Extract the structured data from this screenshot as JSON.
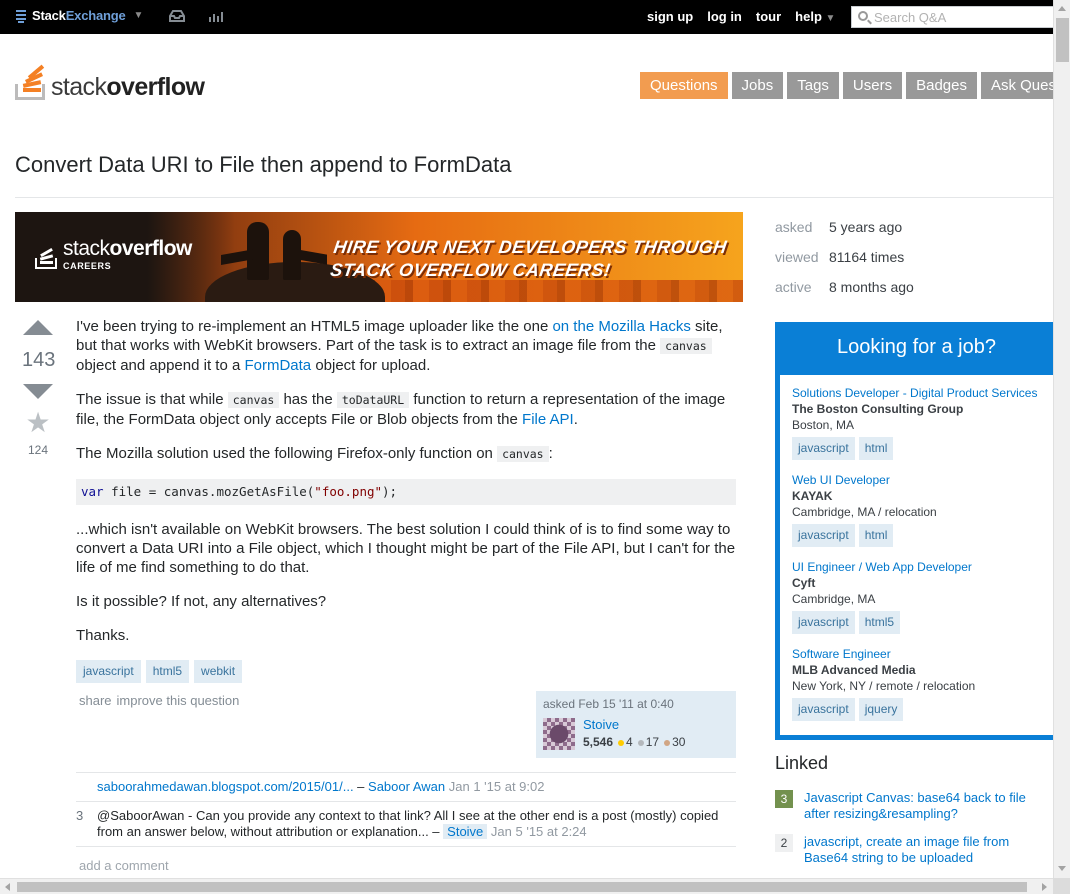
{
  "topbar": {
    "brand_a": "Stack",
    "brand_b": "Exchange",
    "links": [
      "sign up",
      "log in",
      "tour",
      "help"
    ],
    "search_placeholder": "Search Q&A"
  },
  "header": {
    "logo_a": "stack",
    "logo_b": "overflow",
    "nav": [
      "Questions",
      "Jobs",
      "Tags",
      "Users",
      "Badges",
      "Ask Question"
    ]
  },
  "question": {
    "title": "Convert Data URI to File then append to FormData",
    "votes": "143",
    "favorites": "124",
    "p1": {
      "a": "I've been trying to re-implement an HTML5 image uploader like the one ",
      "link1": "on the Mozilla Hacks",
      "b": " site, but that works with WebKit browsers. Part of the task is to extract an image file from the ",
      "code1": "canvas",
      "c": " object and append it to a ",
      "link2": "FormData",
      "d": " object for upload."
    },
    "p2": {
      "a": "The issue is that while ",
      "code1": "canvas",
      "b": " has the ",
      "code2": "toDataURL",
      "c": " function to return a representation of the image file, the FormData object only accepts File or Blob objects from the ",
      "link1": "File API",
      "d": "."
    },
    "p3": {
      "a": "The Mozilla solution used the following Firefox-only function on ",
      "code1": "canvas",
      "b": ":"
    },
    "code_block": {
      "kw": "var",
      "pre": " file = canvas.mozGetAsFile(",
      "str": "\"foo.png\"",
      "post": ");"
    },
    "p4": "...which isn't available on WebKit browsers. The best solution I could think of is to find some way to convert a Data URI into a File object, which I thought might be part of the File API, but I can't for the life of me find something to do that.",
    "p5": "Is it possible? If not, any alternatives?",
    "p6": "Thanks.",
    "tags": [
      "javascript",
      "html5",
      "webkit"
    ],
    "actions": [
      "share",
      "improve this question"
    ],
    "owner": {
      "asked": "asked Feb 15 '11 at 0:40",
      "name": "Stoive",
      "rep": "5,546",
      "gold": "4",
      "silver": "17",
      "bronze": "30"
    }
  },
  "comments": [
    {
      "score": "",
      "text": "saboorahmedawan.blogspot.com/2015/01/...",
      "dash": " – ",
      "user": "Saboor Awan",
      "date": "Jan 1 '15 at 9:02"
    },
    {
      "score": "3",
      "text": "@SaboorAwan - Can you provide any context to that link? All I see at the other end is a post (mostly) copied from an answer below, without attribution or explanation...",
      "dash": " – ",
      "user": "Stoive",
      "date": "Jan 5 '15 at 2:24"
    }
  ],
  "add_comment": "add a comment",
  "meta": {
    "asked_label": "asked",
    "asked_value": "5 years ago",
    "viewed_label": "viewed",
    "viewed_value": "81164 times",
    "active_label": "active",
    "active_value": "8 months ago"
  },
  "banner": {
    "brand_a": "stack",
    "brand_b": "overflow",
    "sub": "CAREERS",
    "line1": "HIRE YOUR NEXT DEVELOPERS THROUGH",
    "line2": "STACK OVERFLOW CAREERS!"
  },
  "jobs": {
    "heading": "Looking for a job?",
    "items": [
      {
        "title": "Solutions Developer - Digital Product Services",
        "company": "The Boston Consulting Group",
        "location": "Boston, MA",
        "tags": [
          "javascript",
          "html"
        ]
      },
      {
        "title": "Web UI Developer",
        "company": "KAYAK",
        "location": "Cambridge, MA / relocation",
        "tags": [
          "javascript",
          "html"
        ]
      },
      {
        "title": "UI Engineer / Web App Developer",
        "company": "Cyft",
        "location": "Cambridge, MA",
        "tags": [
          "javascript",
          "html5"
        ]
      },
      {
        "title": "Software Engineer",
        "company": "MLB Advanced Media",
        "location": "New York, NY / remote / relocation",
        "tags": [
          "javascript",
          "jquery"
        ]
      }
    ]
  },
  "linked": {
    "heading": "Linked",
    "items": [
      {
        "score": "3",
        "title": "Javascript Canvas: base64 back to file after resizing&resampling?"
      },
      {
        "score": "2",
        "title": "javascript, create an image file from Base64 string to be uploaded"
      }
    ]
  },
  "colors": {
    "accent": "#f29c50",
    "link": "#0077cc",
    "jobs_blue": "#0a7fd6",
    "tag_bg": "#e1ecf4"
  }
}
